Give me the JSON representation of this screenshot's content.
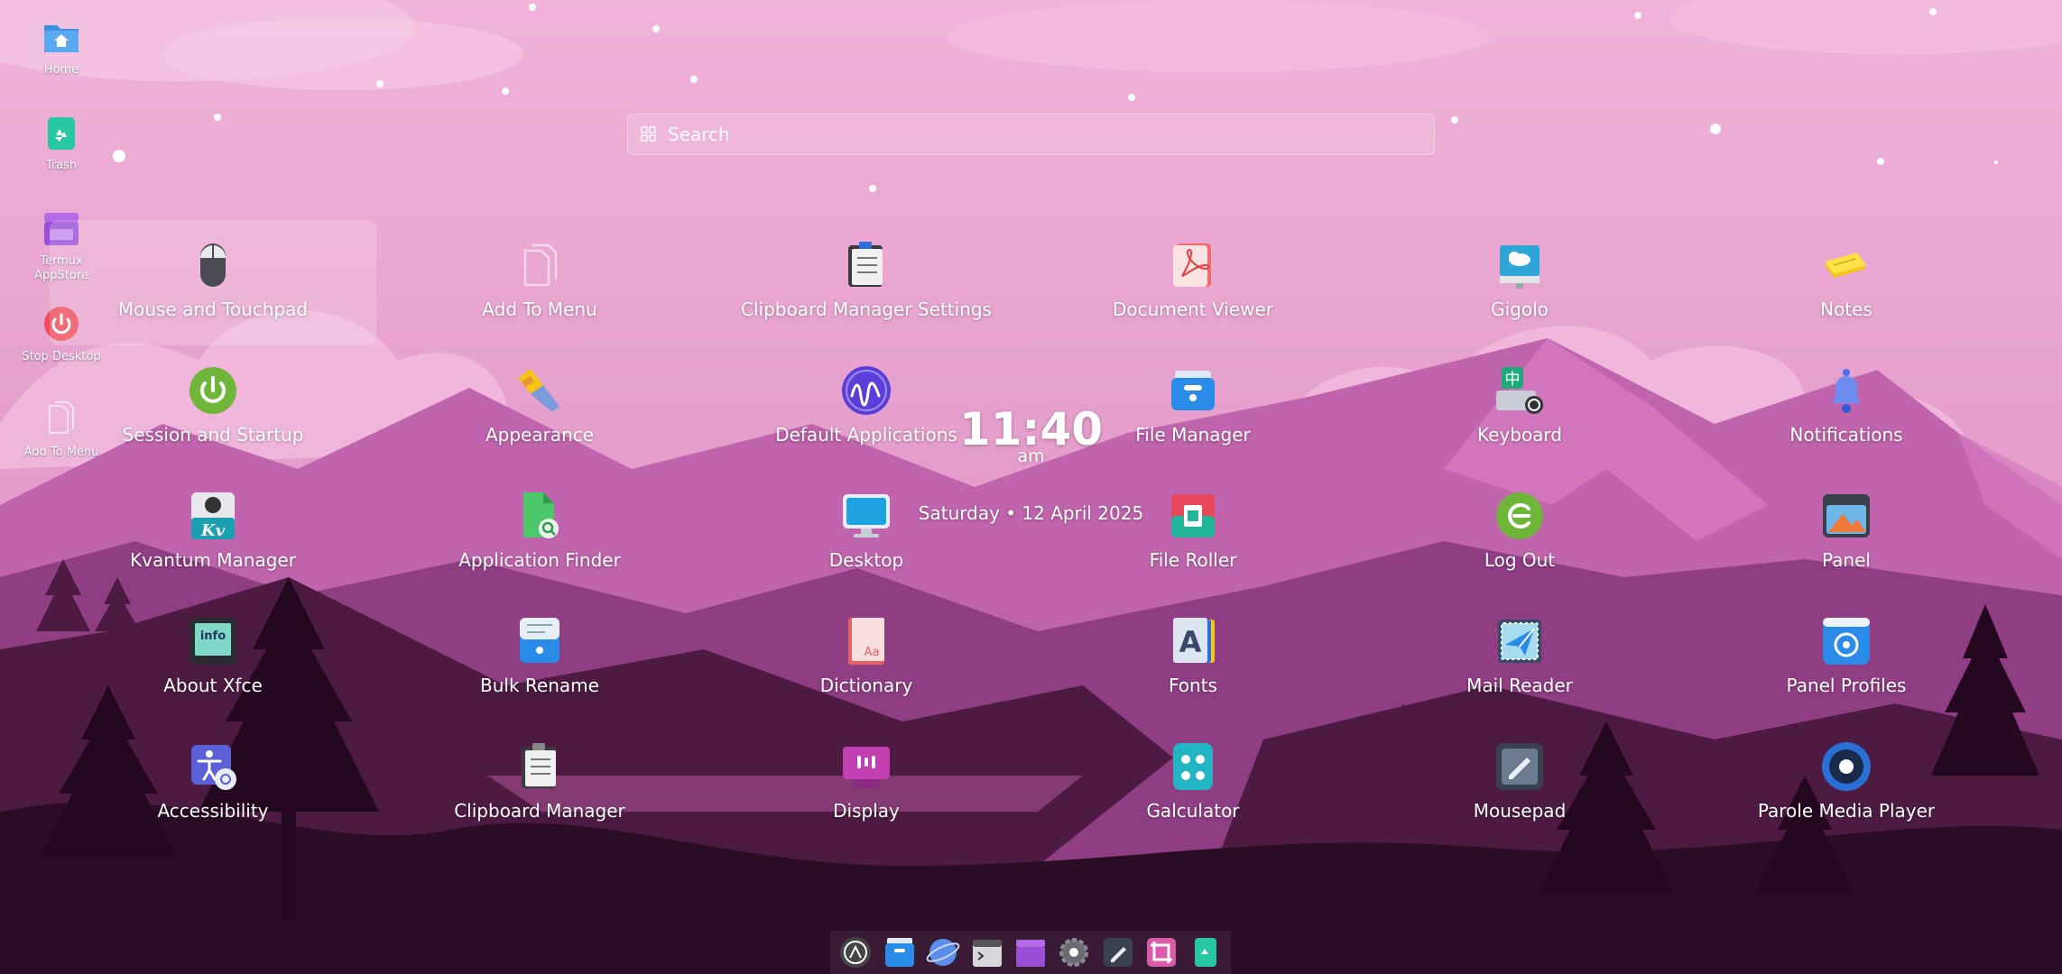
{
  "desktop": {
    "icons": [
      {
        "label": "Home",
        "icon": "home-folder-icon"
      },
      {
        "label": "Trash",
        "icon": "trash-icon"
      },
      {
        "label": "Termux AppStore",
        "icon": "appstore-icon"
      },
      {
        "label": "Stop Desktop",
        "icon": "power-icon"
      },
      {
        "label": "Add To Menu",
        "icon": "add-to-menu-icon"
      }
    ]
  },
  "search": {
    "placeholder": "Search"
  },
  "apps": [
    {
      "label": "Mouse and Touchpad",
      "icon": "mouse-icon"
    },
    {
      "label": "Add To Menu",
      "icon": "add-to-menu-icon"
    },
    {
      "label": "Clipboard Manager Settings",
      "icon": "clipboard-settings-icon"
    },
    {
      "label": "Document Viewer",
      "icon": "pdf-document-icon"
    },
    {
      "label": "Gigolo",
      "icon": "network-drive-icon"
    },
    {
      "label": "Notes",
      "icon": "notes-icon"
    },
    {
      "label": "Session and Startup",
      "icon": "power-icon"
    },
    {
      "label": "Appearance",
      "icon": "paintbrush-icon"
    },
    {
      "label": "Default Applications",
      "icon": "default-apps-icon"
    },
    {
      "label": "File Manager",
      "icon": "file-manager-icon"
    },
    {
      "label": "Keyboard",
      "icon": "keyboard-icon"
    },
    {
      "label": "Notifications",
      "icon": "bell-icon"
    },
    {
      "label": "Kvantum Manager",
      "icon": "kvantum-icon"
    },
    {
      "label": "Application Finder",
      "icon": "app-finder-icon"
    },
    {
      "label": "Desktop",
      "icon": "monitor-icon"
    },
    {
      "label": "File Roller",
      "icon": "archive-icon"
    },
    {
      "label": "Log Out",
      "icon": "logout-icon"
    },
    {
      "label": "Panel",
      "icon": "panel-icon"
    },
    {
      "label": "About Xfce",
      "icon": "info-icon"
    },
    {
      "label": "Bulk Rename",
      "icon": "bulk-rename-icon"
    },
    {
      "label": "Dictionary",
      "icon": "dictionary-icon"
    },
    {
      "label": "Fonts",
      "icon": "fonts-icon"
    },
    {
      "label": "Mail Reader",
      "icon": "mail-icon"
    },
    {
      "label": "Panel Profiles",
      "icon": "panel-profiles-icon"
    },
    {
      "label": "Accessibility",
      "icon": "accessibility-icon"
    },
    {
      "label": "Clipboard Manager",
      "icon": "clipboard-icon"
    },
    {
      "label": "Display",
      "icon": "display-icon"
    },
    {
      "label": "Galculator",
      "icon": "calculator-icon"
    },
    {
      "label": "Mousepad",
      "icon": "text-editor-icon"
    },
    {
      "label": "Parole Media Player",
      "icon": "media-player-icon"
    }
  ],
  "selected_app": "Mouse and Touchpad",
  "clock": {
    "time": "11:40",
    "ampm": "am",
    "date": "Saturday  •  12 April 2025"
  },
  "dock": {
    "items": [
      "launcher-icon",
      "file-manager-icon",
      "browser-icon",
      "terminal-icon",
      "appstore-icon",
      "settings-icon",
      "text-editor-icon",
      "screenshot-icon",
      "trash-icon"
    ]
  },
  "colors": {
    "sky": "#e9a9d2",
    "mountain_far": "#a9569d",
    "mountain_mid": "#7c3470",
    "mountain_dark": "#3d1332",
    "foreground": "#220a1c"
  }
}
